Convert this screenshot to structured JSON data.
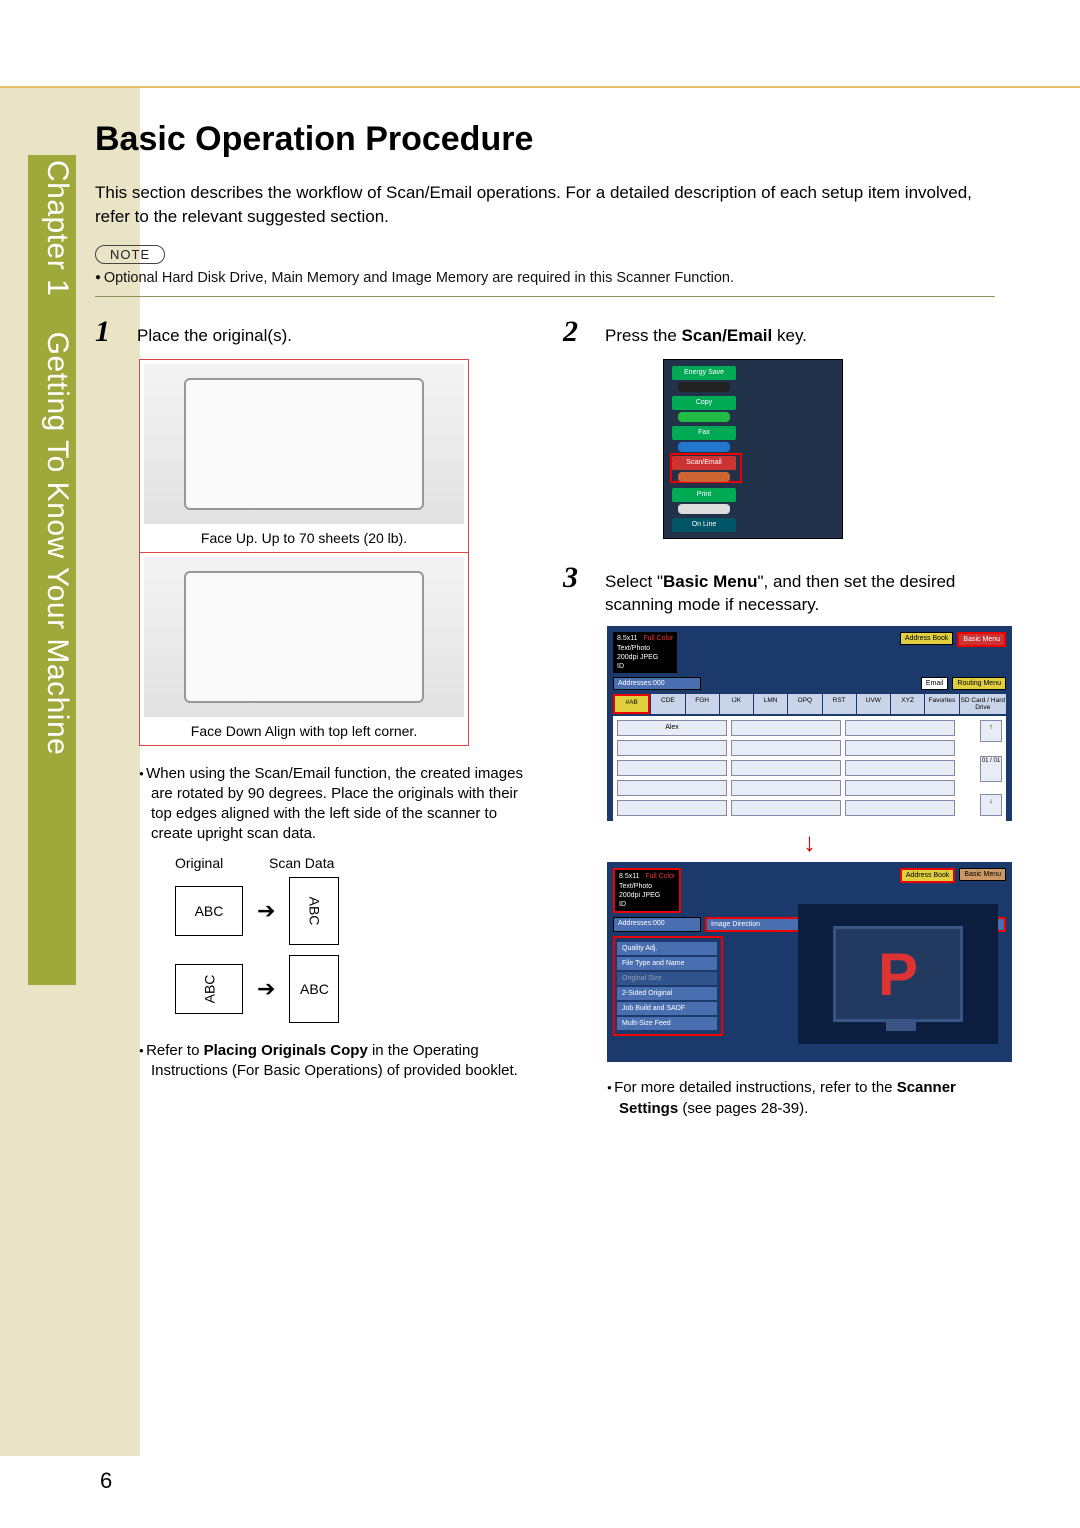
{
  "chapter": {
    "label": "Chapter",
    "number": "1",
    "subtitle": "Getting To Know Your Machine"
  },
  "title": "Basic Operation Procedure",
  "intro": "This section describes the workflow of Scan/Email operations. For a detailed description of each setup item involved, refer to the relevant suggested section.",
  "note_label": "NOTE",
  "note_text": "Optional Hard Disk Drive, Main Memory and Image Memory are required in this Scanner Function.",
  "steps": {
    "s1": {
      "num": "1",
      "text": "Place the original(s)."
    },
    "s2": {
      "num": "2",
      "text_pre": "Press the ",
      "bold": "Scan/Email",
      "text_post": " key."
    },
    "s3": {
      "num": "3",
      "text_pre": "Select \"",
      "bold": "Basic Menu",
      "text_post": "\", and then set the desired scanning mode if necessary."
    }
  },
  "fig1_caption": "Face Up. Up to 70 sheets (20 lb).",
  "fig2_caption": "Face Down Align with top left corner.",
  "rotate_note": "When using the Scan/Email function, the created images are rotated by 90 degrees. Place the originals with their top edges aligned with the left side of the scanner to create upright scan data.",
  "rot_headers": {
    "orig": "Original",
    "scan": "Scan Data"
  },
  "abc": "ABC",
  "refer1_pre": "Refer to ",
  "refer1_bold": "Placing Originals Copy",
  "refer1_post": " in the Operating Instructions (For Basic Operations) of provided booklet.",
  "panel_labels": {
    "energy": "Energy Save",
    "copy": "Copy",
    "fax": "Fax",
    "scan": "Scan/Email",
    "print": "Print",
    "online": "On Line"
  },
  "screen": {
    "size": "8.5x11",
    "color": "Full Color",
    "mode": "Text/Photo",
    "res": "200dpi JPEG",
    "id": "ID",
    "addr": "Addresses:000",
    "address_book": "Address Book",
    "basic_menu": "Basic Menu",
    "email": "Email",
    "routing": "Routing Menu",
    "tabs": [
      "#AB",
      "CDE",
      "FGH",
      "IJK",
      "LMN",
      "OPQ",
      "RST",
      "UVW",
      "XYZ",
      "Favorites",
      "SD Card / Hard Drive"
    ],
    "alex": "Alex",
    "page": "01 / 01",
    "img_dir": "Image Direction",
    "side": [
      "Quality Adj.",
      "File Type and Name",
      "Original Size",
      "2-Sided Original",
      "Job Build and SADF",
      "Multi-Size Feed"
    ]
  },
  "refer2_pre": "For more detailed instructions, refer to the ",
  "refer2_bold": "Scanner Settings",
  "refer2_post": " (see pages 28-39).",
  "page_number": "6"
}
